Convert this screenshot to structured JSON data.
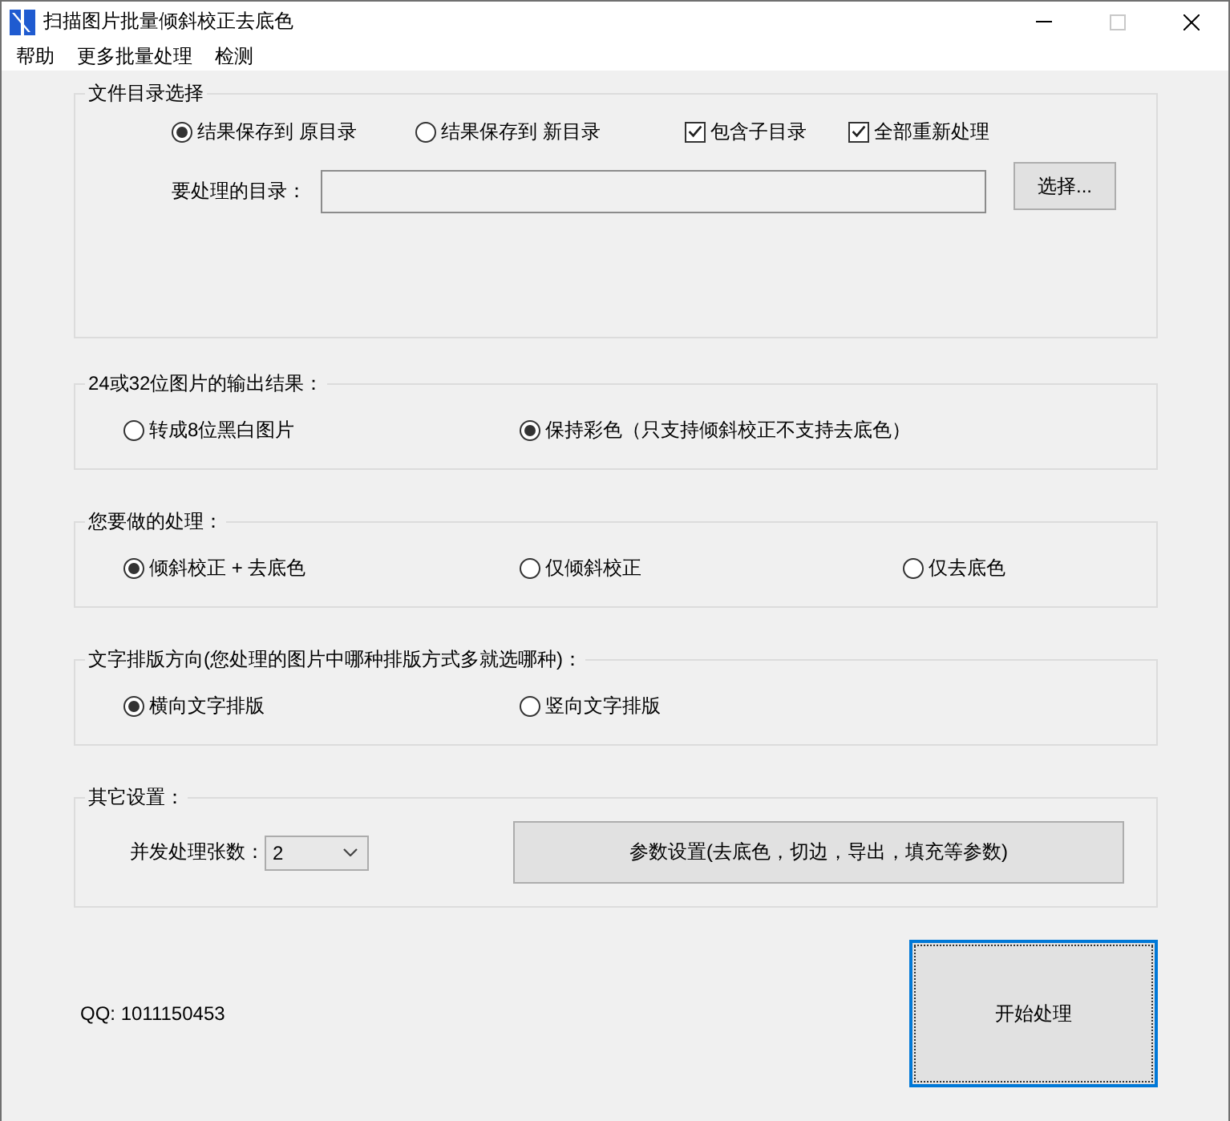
{
  "window": {
    "title": "扫描图片批量倾斜校正去底色",
    "controls": [
      {
        "kind": "minimize",
        "disabled": false
      },
      {
        "kind": "maximize",
        "disabled": true
      },
      {
        "kind": "close",
        "disabled": false
      }
    ]
  },
  "menu": [
    "帮助",
    "更多批量处理",
    "检测"
  ],
  "groups": [
    {
      "kind": "directory",
      "title": "文件目录选择",
      "options": [
        {
          "kind": "radio",
          "label": "结果保存到 原目录",
          "selected": true
        },
        {
          "kind": "radio",
          "label": "结果保存到 新目录",
          "selected": false
        },
        {
          "kind": "checkbox",
          "label": "包含子目录",
          "checked": true
        },
        {
          "kind": "checkbox",
          "label": "全部重新处理",
          "checked": true
        }
      ],
      "field_label": "要处理的目录：",
      "browse_button": "选择..."
    },
    {
      "kind": "choices",
      "title": "24或32位图片的输出结果：",
      "options": [
        {
          "label": "转成8位黑白图片",
          "selected": false
        },
        {
          "label": "保持彩色（只支持倾斜校正不支持去底色）",
          "selected": true
        }
      ]
    },
    {
      "kind": "choices",
      "title": "您要做的处理：",
      "options": [
        {
          "label": "倾斜校正 + 去底色",
          "selected": true
        },
        {
          "label": "仅倾斜校正",
          "selected": false
        },
        {
          "label": "仅去底色",
          "selected": false
        }
      ]
    },
    {
      "kind": "choices",
      "title": "文字排版方向(您处理的图片中哪种排版方式多就选哪种)：",
      "options": [
        {
          "label": "横向文字排版",
          "selected": true
        },
        {
          "label": "竖向文字排版",
          "selected": false
        }
      ]
    },
    {
      "kind": "settings",
      "title": "其它设置：",
      "count_label": "并发处理张数：",
      "count_value": "2",
      "params_button": "参数设置(去底色，切边，导出，填充等参数)"
    }
  ],
  "footer": {
    "qq": "QQ: 1011150453",
    "start_button": {
      "label": "开始处理",
      "focused": true
    }
  }
}
